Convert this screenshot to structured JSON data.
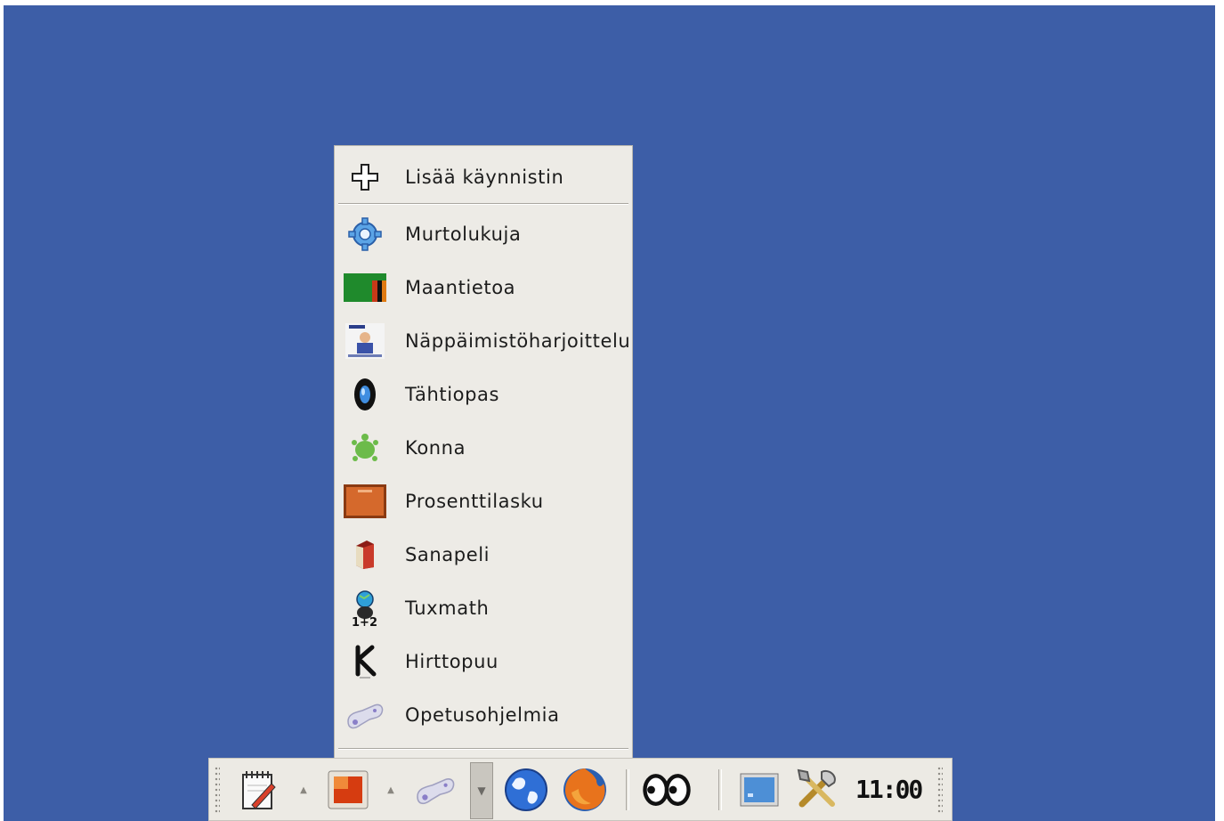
{
  "menu": {
    "add_launcher": "Lisää käynnistin",
    "items": [
      {
        "label": "Murtolukuja",
        "icon": "gear-icon"
      },
      {
        "label": "Maantietoa",
        "icon": "map-flag-icon"
      },
      {
        "label": "Näppäimistöharjoittelu",
        "icon": "ktouch-icon"
      },
      {
        "label": "Tähtiopas",
        "icon": "telescope-lens-icon"
      },
      {
        "label": "Konna",
        "icon": "turtle-icon"
      },
      {
        "label": "Prosenttilasku",
        "icon": "percentage-board-icon"
      },
      {
        "label": "Sanapeli",
        "icon": "book-icon"
      },
      {
        "label": "Tuxmath",
        "icon": "tuxmath-icon"
      },
      {
        "label": "Hirttopuu",
        "icon": "hangman-icon"
      },
      {
        "label": "Opetusohjelmia",
        "icon": "gamepad-icon"
      }
    ]
  },
  "panel": {
    "clock": "11:00",
    "launchers": [
      "notepad-icon",
      "presentation-icon",
      "gamepad-icon",
      "globe-icon",
      "firefox-icon",
      "eyes-icon",
      "desktop-icon",
      "tools-icon"
    ]
  },
  "colors": {
    "desktop": "#3d5ea7",
    "menu_bg": "#edebe6",
    "panel_bg": "#eceae4"
  }
}
